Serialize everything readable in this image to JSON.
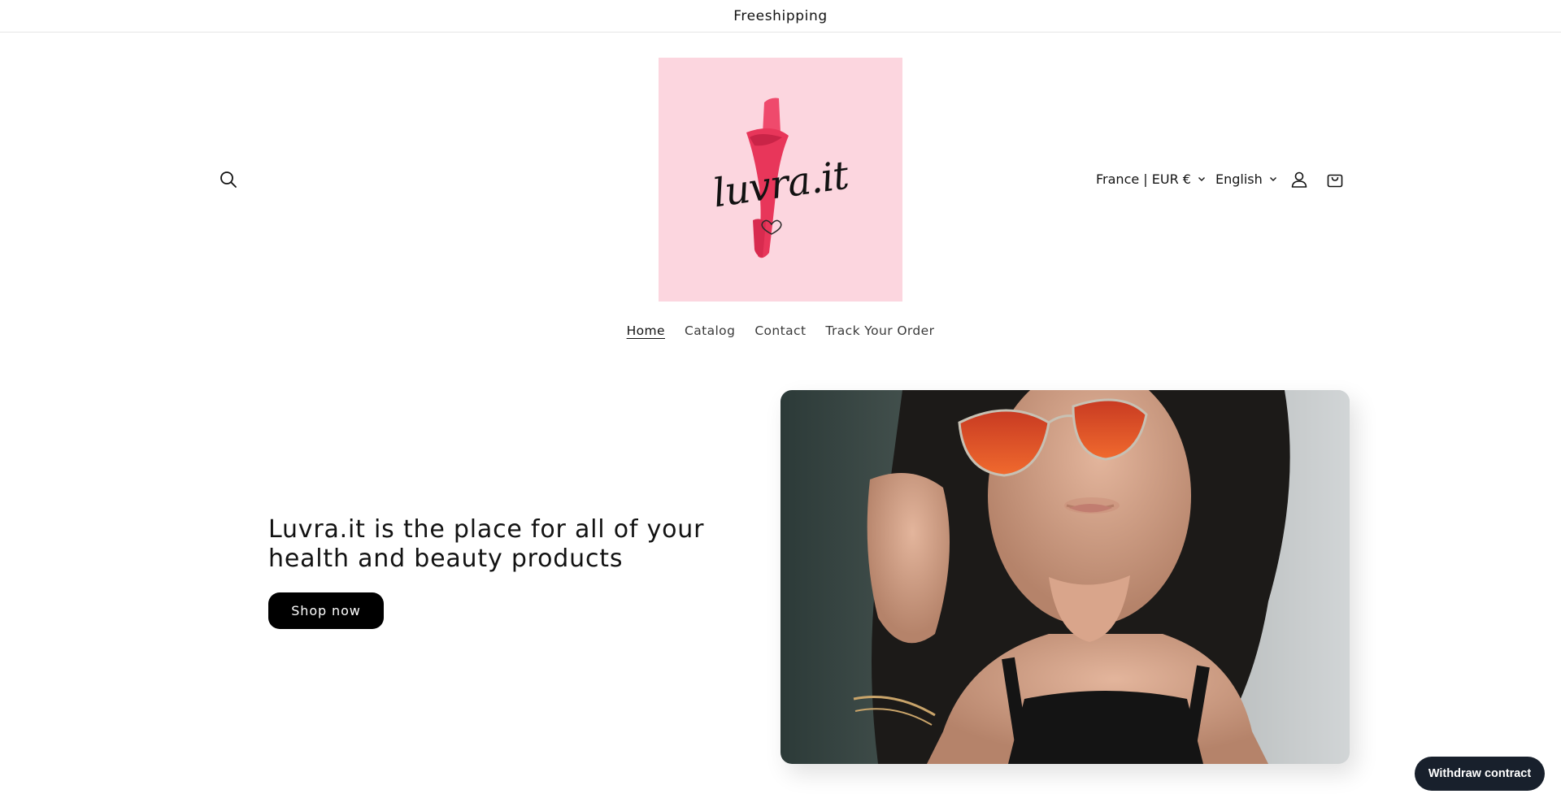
{
  "announcement": {
    "text": "Freeshipping"
  },
  "header": {
    "logo_text": "luvra.it",
    "country_selector": "France | EUR €",
    "language_selector": "English"
  },
  "nav": {
    "items": [
      {
        "label": "Home",
        "active": true
      },
      {
        "label": "Catalog",
        "active": false
      },
      {
        "label": "Contact",
        "active": false
      },
      {
        "label": "Track Your Order",
        "active": false
      }
    ]
  },
  "hero": {
    "title": "Luvra.it is the place for all of your health and beauty products",
    "button_label": "Shop now",
    "image": "woman-orange-sunglasses-photo"
  },
  "floating": {
    "withdraw_label": "Withdraw contract"
  },
  "colors": {
    "logo_bg": "#fcd6df",
    "lipstick": "#e8365a",
    "button_bg": "#000000",
    "withdraw_bg": "#18202c"
  },
  "icons": [
    "search-icon",
    "account-icon",
    "cart-icon",
    "chevron-down-icon"
  ]
}
